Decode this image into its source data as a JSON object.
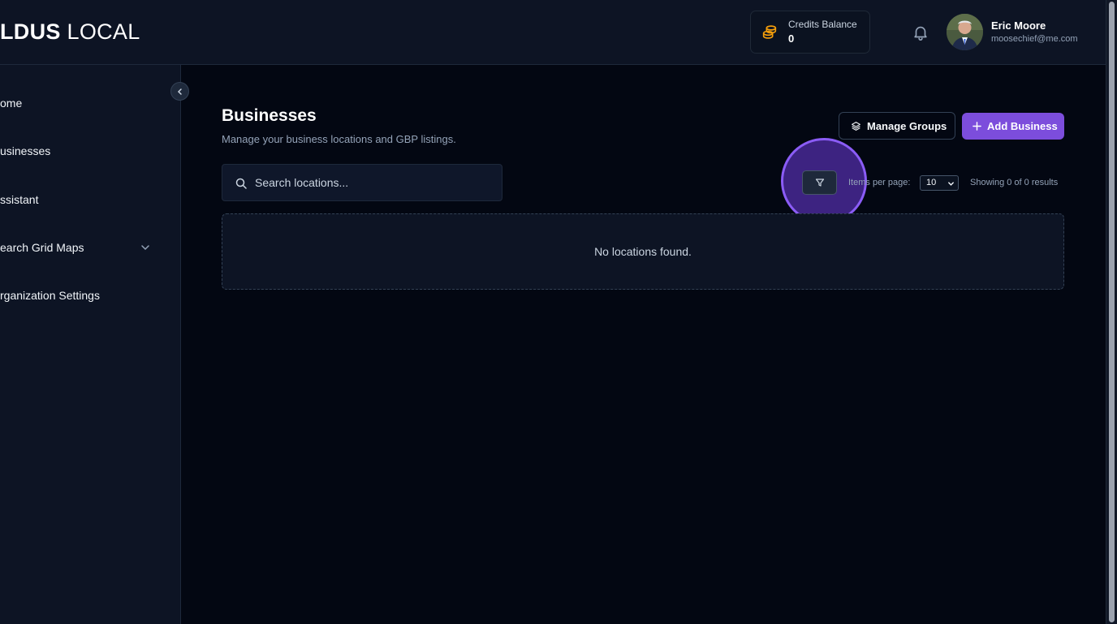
{
  "header": {
    "logo_bold": "LDUS",
    "logo_light": "LOCAL",
    "credits_label": "Credits Balance",
    "credits_value": "0",
    "credits_icon": "coins-icon",
    "bell_icon": "bell-icon",
    "user_name": "Eric Moore",
    "user_email": "moosechief@me.com"
  },
  "sidebar": {
    "items": [
      {
        "label": "ome"
      },
      {
        "label": "usinesses"
      },
      {
        "label": "ssistant"
      },
      {
        "label": "earch Grid Maps"
      },
      {
        "label": "rganization Settings"
      }
    ]
  },
  "main": {
    "title": "Businesses",
    "subtitle": "Manage your business locations and GBP listings.",
    "manage_groups_label": "Manage Groups",
    "add_business_label": "Add Business",
    "search_placeholder": "Search locations...",
    "items_per_page_label": "Items per page:",
    "items_per_page_value": "10",
    "showing_text": "Showing 0 of 0 results",
    "empty_text": "No locations found."
  },
  "colors": {
    "accent": "#7c4ddc",
    "background": "#030712",
    "panel": "#0d1424"
  }
}
